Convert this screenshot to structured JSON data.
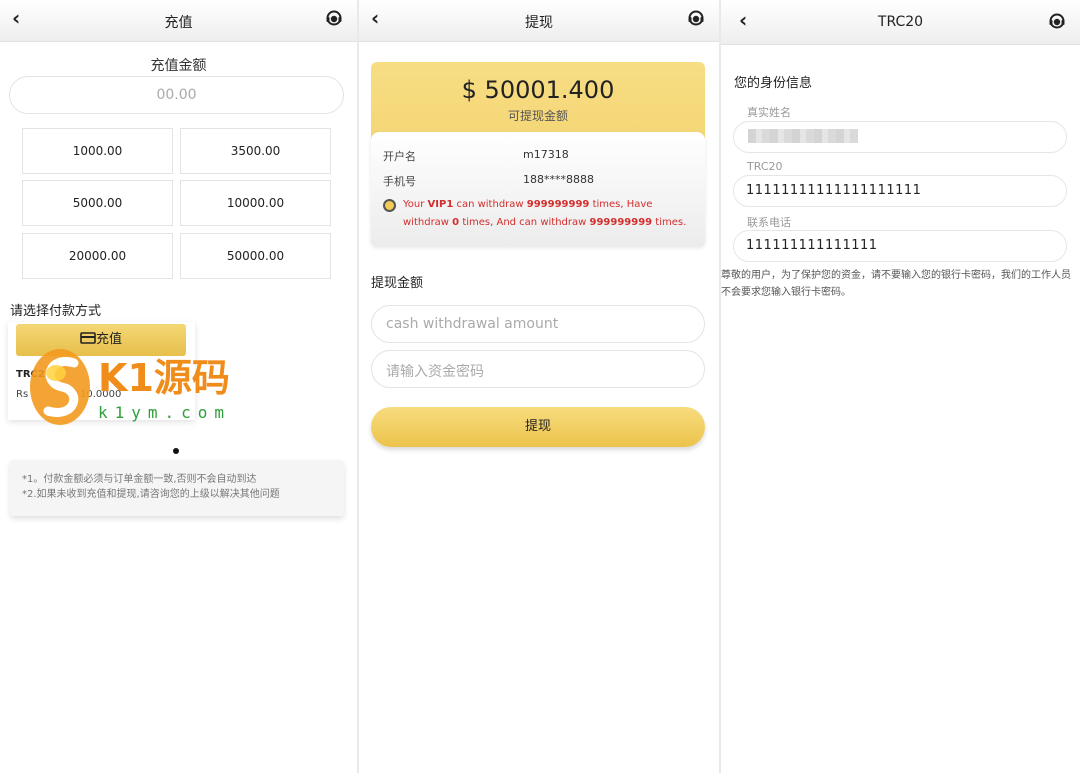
{
  "panel1": {
    "header": {
      "back": "‹",
      "title": "充值"
    },
    "amount_label": "充值金额",
    "amount_placeholder": "00.00",
    "amounts": [
      "1000.00",
      "3500.00",
      "5000.00",
      "10000.00",
      "20000.00",
      "50000.00"
    ],
    "payment_label": "请选择付款方式",
    "pay_button": "充值",
    "pay_card": {
      "name": "TRC20",
      "rate_prefix": "Rs",
      "rate_value": "10.0000"
    },
    "notes": [
      "*1。付款金额必须与订单金额一致,否则不会自动到达",
      "*2.如果未收到充值和提现,请咨询您的上级以解决其他问题"
    ],
    "watermark": {
      "brand": "K1源码",
      "domain": "k1ym.com"
    }
  },
  "panel2": {
    "header": {
      "back": "‹",
      "title": "提现"
    },
    "balance": "$ 50001.400",
    "balance_label": "可提现金额",
    "account_name_label": "开户名",
    "account_name": "m17318",
    "phone_label": "手机号",
    "phone": "188****8888",
    "vip": {
      "t1": "Your ",
      "b1": "VIP1",
      "t2": " can withdraw ",
      "b2": "999999999",
      "t3": " times, Have withdraw ",
      "b3": "0",
      "t4": " times, And can withdraw ",
      "b4": "999999999",
      "t5": " times."
    },
    "withdraw_label": "提现金额",
    "amount_placeholder": "cash withdrawal amount",
    "password_placeholder": "请输入资金密码",
    "submit": "提现"
  },
  "panel3": {
    "header": {
      "back": "‹",
      "title": "TRC20"
    },
    "section_title": "您的身份信息",
    "name_label": "真实姓名",
    "trc_label": "TRC20",
    "trc_value": "11111111111111111111",
    "phone_label": "联系电话",
    "phone_value": "111111111111111",
    "warning": "尊敬的用户，为了保护您的资金，请不要输入您的银行卡密码，我们的工作人员不会要求您输入银行卡密码。"
  },
  "colors": {
    "gold": "#f0cd62",
    "red": "#d42d2d"
  },
  "icons": {
    "back": "chevron-left-icon",
    "service": "headset-icon",
    "card": "card-icon"
  }
}
